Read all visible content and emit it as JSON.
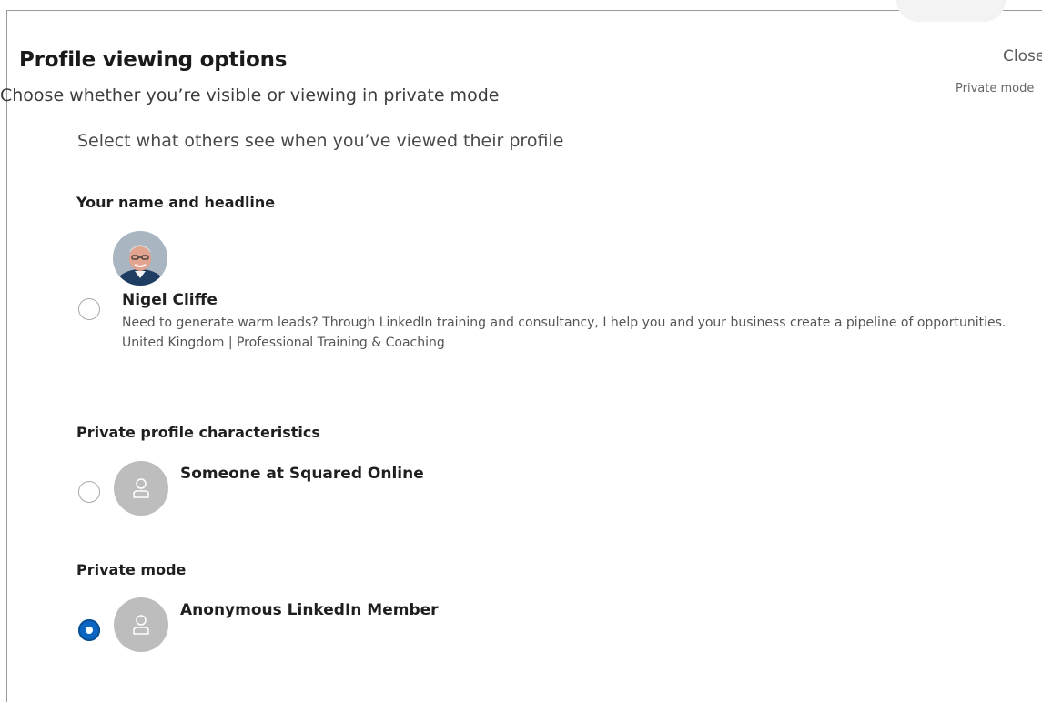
{
  "dialog": {
    "title": "Profile viewing options",
    "subtitle": "Choose whether you’re visible or viewing in private mode",
    "close_label": "Close",
    "private_mode_label": "Private mode"
  },
  "instruction": "Select what others see when you’ve viewed their profile",
  "sections": {
    "name_headline": {
      "heading": "Your name and headline",
      "selected": false,
      "name": "Nigel Cliffe",
      "headline": "Need to generate warm leads? Through LinkedIn training and consultancy, I help you and your business create a pipeline of opportunities.",
      "location_industry": "United Kingdom | Professional Training & Coaching",
      "avatar_icon": "profile-photo"
    },
    "private_characteristics": {
      "heading": "Private profile characteristics",
      "selected": false,
      "label": "Someone at Squared Online",
      "avatar_icon": "person-icon"
    },
    "private_mode": {
      "heading": "Private mode",
      "selected": true,
      "label": "Anonymous LinkedIn Member",
      "avatar_icon": "person-icon"
    }
  },
  "colors": {
    "accent": "#0a66c2",
    "radio_border": "#a8a8a8",
    "ghost_avatar": "#bdbdbd"
  }
}
